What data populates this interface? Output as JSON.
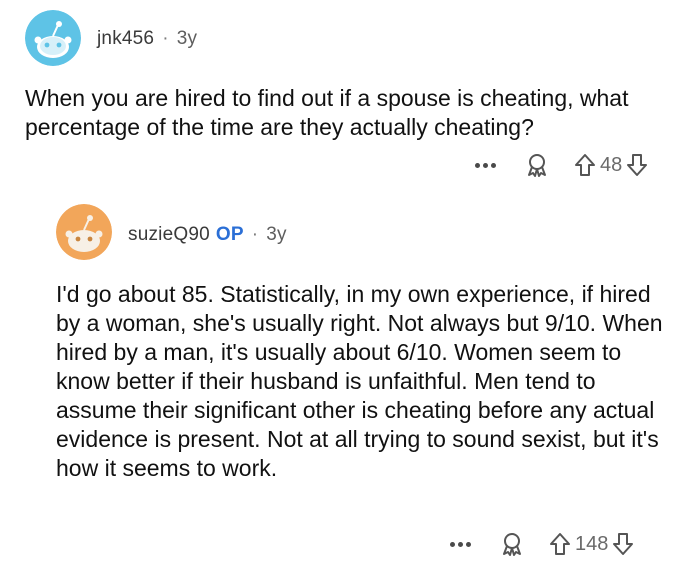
{
  "comments": [
    {
      "username": "jnk456",
      "separator": "·",
      "age": "3y",
      "body": "When you are hired to find out if a spouse is cheating, what percentage of the time are they actually cheating?",
      "votes": "48",
      "avatar_color": "#5ec3e6"
    },
    {
      "username": "suzieQ90",
      "op_badge": "OP",
      "separator": "·",
      "age": "3y",
      "body": "I'd go about 85. Statistically, in my own experience, if hired by a woman, she's usually right. Not always but 9/10. When hired by a man, it's usually about 6/10. Women seem to know better if their husband is unfaithful. Men tend to assume their significant other is cheating before any actual evidence is present. Not at all trying to sound sexist, but it's how it seems to work.",
      "votes": "148",
      "avatar_color": "#f2a65a"
    }
  ],
  "icons": {
    "more": "more-options-icon",
    "award": "award-icon",
    "upvote": "upvote-arrow-icon",
    "downvote": "downvote-arrow-icon"
  }
}
